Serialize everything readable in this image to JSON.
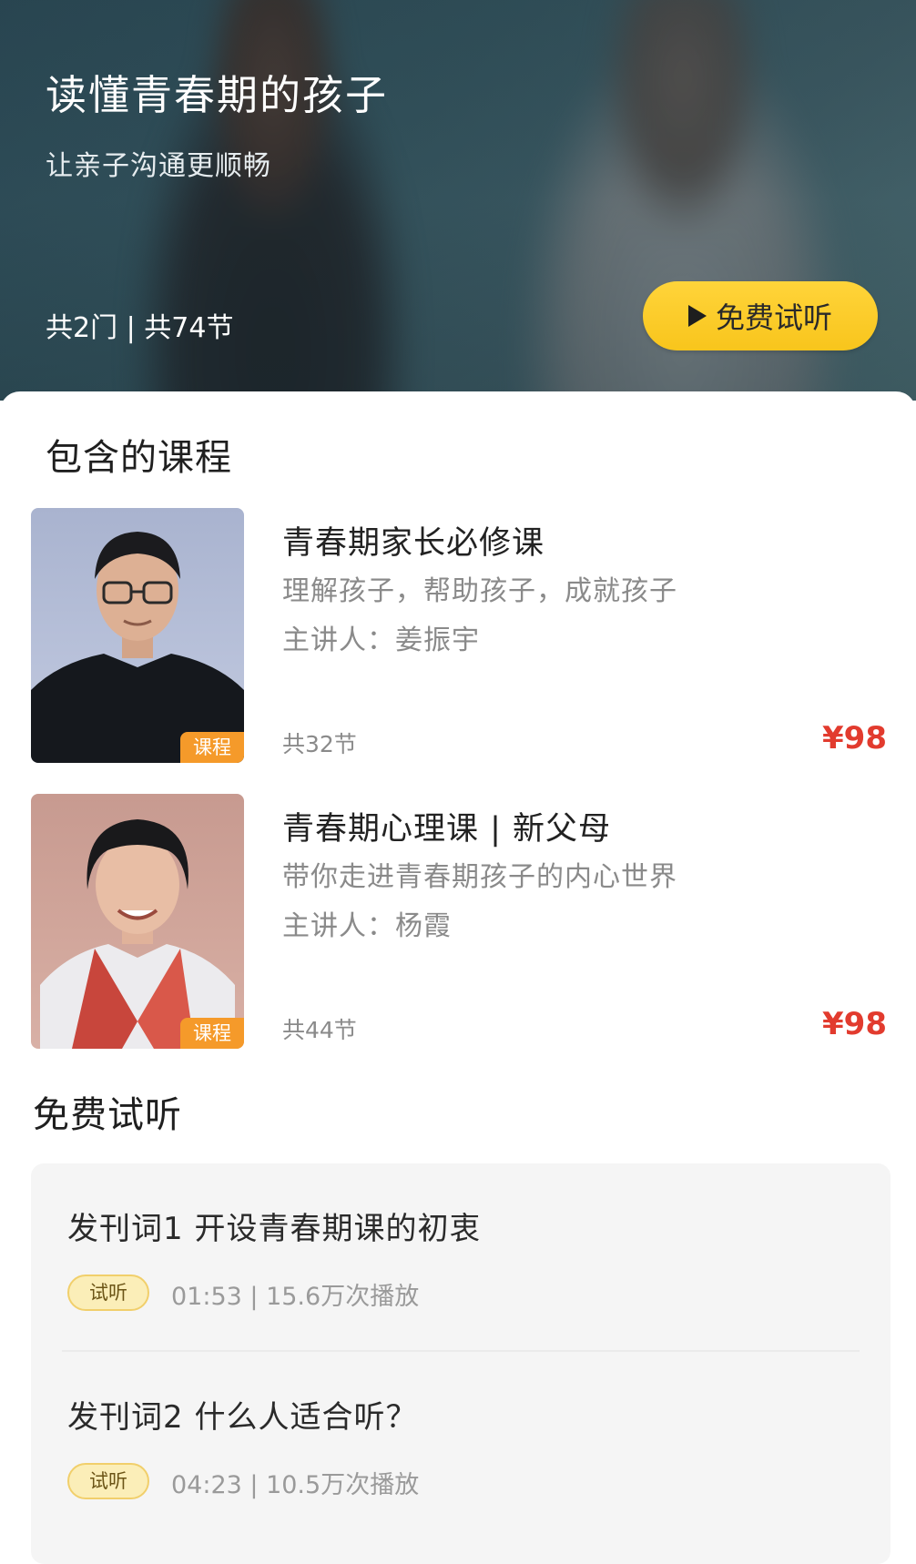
{
  "hero": {
    "title": "读懂青春期的孩子",
    "subtitle": "让亲子沟通更顺畅",
    "stats": "共2门 | 共74节",
    "trial_button_label": "免费试听"
  },
  "included_section": {
    "title": "包含的课程",
    "courses": [
      {
        "title": "青春期家长必修课",
        "description": "理解孩子，帮助孩子，成就孩子",
        "lecturer": "主讲人：姜振宇",
        "tag": "课程",
        "lessons": "共32节",
        "price": "¥98"
      },
      {
        "title": "青春期心理课 | 新父母",
        "description": "带你走进青春期孩子的内心世界",
        "lecturer": "主讲人：杨霞",
        "tag": "课程",
        "lessons": "共44节",
        "price": "¥98"
      }
    ]
  },
  "trial_section": {
    "title": "免费试听",
    "items": [
      {
        "title": "发刊词1 开设青春期课的初衷",
        "badge": "试听",
        "meta": "01:53 | 15.6万次播放"
      },
      {
        "title": "发刊词2 什么人适合听？",
        "badge": "试听",
        "meta": "04:23 | 10.5万次播放"
      }
    ]
  },
  "colors": {
    "accent_yellow": "#f8c51c",
    "price_red": "#e23b2e",
    "tag_orange": "#f59a2a"
  }
}
